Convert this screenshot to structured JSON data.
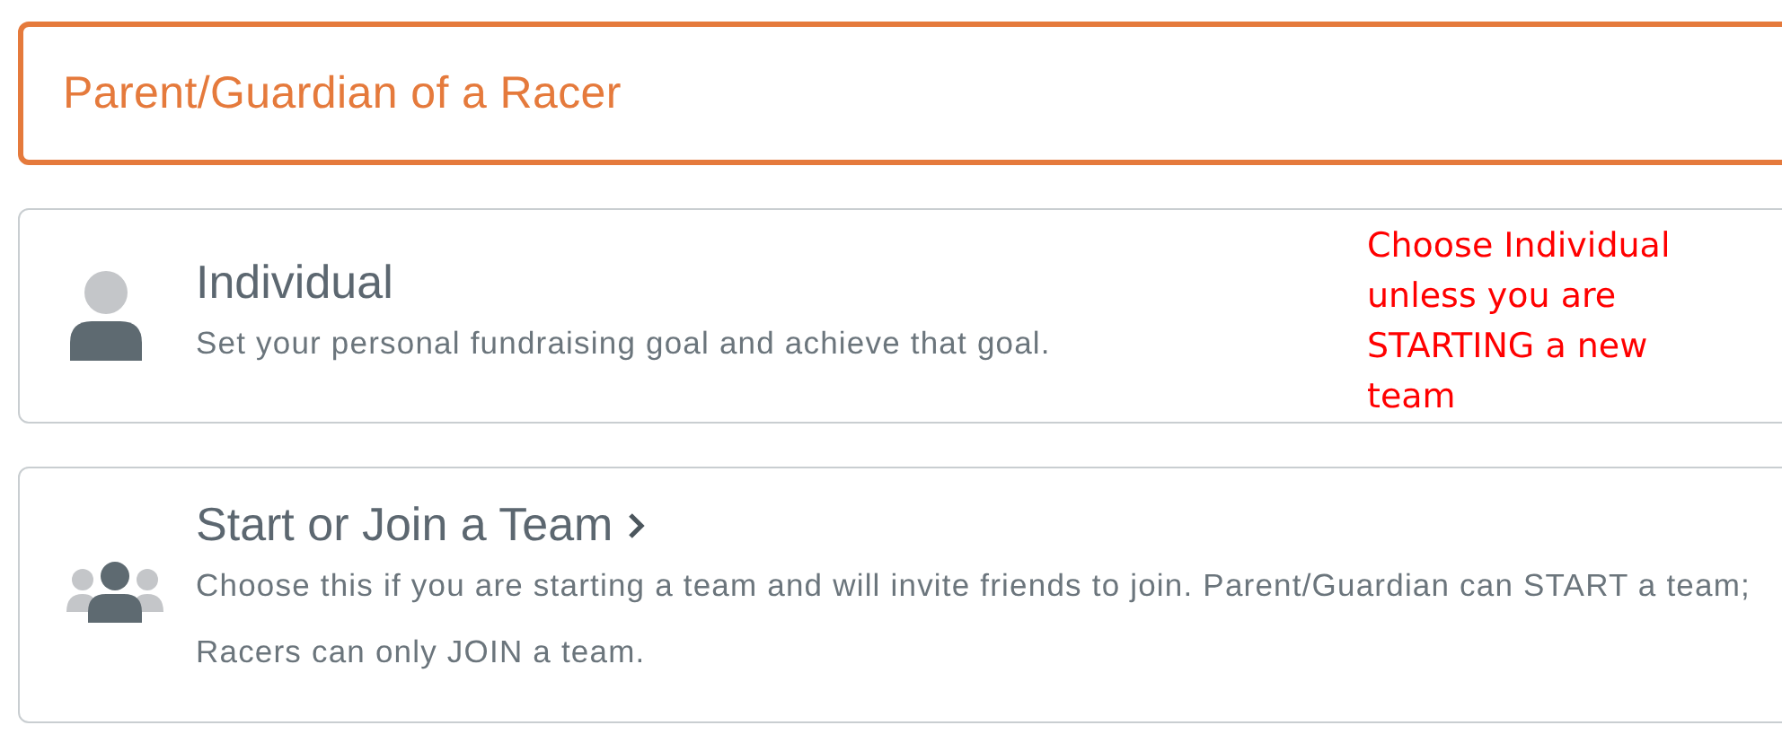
{
  "options": [
    {
      "kind": "plain",
      "title": "Parent/Guardian of a Racer",
      "selected": true
    },
    {
      "kind": "individual",
      "title": "Individual",
      "description": "Set your personal fundraising goal and achieve that goal.",
      "selected": false
    },
    {
      "kind": "team",
      "title": "Start or Join a Team",
      "description": "Choose this if you are starting a team and will invite friends to join. Parent/Guardian can START a team; Racers can only JOIN a team.",
      "selected": false
    }
  ],
  "annotation": {
    "text": "Choose Individual unless you are STARTING a new team",
    "color": "#ff0000"
  }
}
